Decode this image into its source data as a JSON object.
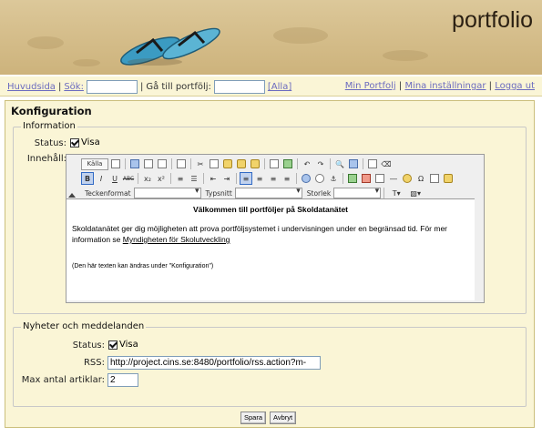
{
  "header": {
    "brand": "portfolio"
  },
  "nav": {
    "home": "Huvudsida",
    "search_link": "Sök:",
    "search_value": "",
    "goto_label": "Gå till portfölj:",
    "goto_value": "",
    "all_link": "[Alla]",
    "my_portfolio": "Min Portfolj",
    "my_settings": "Mina inställningar",
    "logout": "Logga ut",
    "sep": "|"
  },
  "panel": {
    "title": "Konfiguration",
    "information": {
      "legend": "Information",
      "status_label": "Status:",
      "status_checkbox_label": "Visa",
      "status_checked": true,
      "content_label": "Innehåll:"
    },
    "news": {
      "legend": "Nyheter och meddelanden",
      "status_label": "Status:",
      "status_checkbox_label": "Visa",
      "status_checked": true,
      "rss_label": "RSS:",
      "rss_value": "http://project.cins.se:8480/portfolio/rss.action?m-",
      "max_label": "Max antal artiklar:",
      "max_value": "2"
    },
    "save_button": "Spara",
    "cancel_button": "Avbryt"
  },
  "editor": {
    "toolbar": {
      "source_button": "Källa",
      "bold": "B",
      "italic": "I",
      "underline": "U",
      "strike": "ABC",
      "subscript": "x₂",
      "superscript": "x²",
      "format_label": "Teckenformat",
      "font_label": "Typsnitt",
      "size_label": "Storlek",
      "format_value": "",
      "font_value": "",
      "size_value": ""
    },
    "content": {
      "title": "Välkommen till portföljer på Skoldatanätet",
      "body": "Skoldatanätet ger dig möjligheten att prova portföljsystemet i undervisningen under en begränsad tid. För mer information se ",
      "link": "Myndigheten för Skolutveckling",
      "note": "(Den här texten kan ändras under \"Konfiguration\")"
    }
  },
  "colors": {
    "panel_bg": "#faf5d6",
    "panel_border": "#cbbf7c",
    "link": "#6b6bbf",
    "header_sand": "#d6bf8d"
  }
}
